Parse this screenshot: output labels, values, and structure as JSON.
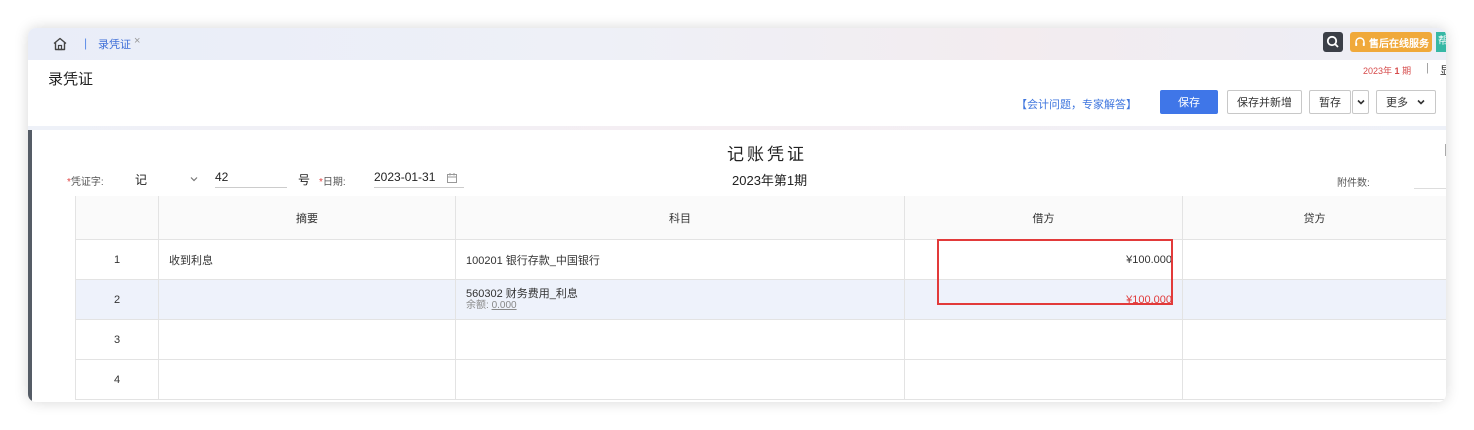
{
  "tabbar": {
    "separator": "|",
    "tab_label": "录凭证",
    "close": "×",
    "service_label": "售后在线服务",
    "extra_label": "帮"
  },
  "header": {
    "title": "录凭证",
    "period_year": "2023年",
    "period_num": "1",
    "period_unit": "期",
    "period_sep": "|",
    "period_more": "显",
    "expert_link": "【会计问题，专家解答】",
    "save": "保存",
    "save_new": "保存并新增",
    "temp_save": "暂存",
    "more": "更多"
  },
  "voucher": {
    "title": "记账凭证",
    "period": "2023年第1期",
    "type_label": "凭证字:",
    "type_value": "记",
    "number": "42",
    "hao": "号",
    "date_label": "日期:",
    "date_value": "2023-01-31",
    "attach_label": "附件数:",
    "required_mark": "*"
  },
  "table": {
    "headers": {
      "summary": "摘要",
      "account": "科目",
      "debit": "借方",
      "credit": "贷方"
    },
    "rows": [
      {
        "no": "1",
        "summary": "收到利息",
        "account": "100201 银行存款_中国银行",
        "balance_label": "",
        "balance": "",
        "debit": "¥100.000",
        "credit": ""
      },
      {
        "no": "2",
        "summary": "",
        "account": "560302 财务费用_利息",
        "balance_label": "余额:",
        "balance": "0.000",
        "debit": "¥100.000",
        "credit": ""
      },
      {
        "no": "3",
        "summary": "",
        "account": "",
        "balance_label": "",
        "balance": "",
        "debit": "",
        "credit": ""
      },
      {
        "no": "4",
        "summary": "",
        "account": "",
        "balance_label": "",
        "balance": "",
        "debit": "",
        "credit": ""
      }
    ]
  },
  "colors": {
    "accent": "#3f76e8",
    "service": "#f0a93a",
    "highlight": "#e23a3a",
    "debit_red": "#e03a3a"
  }
}
